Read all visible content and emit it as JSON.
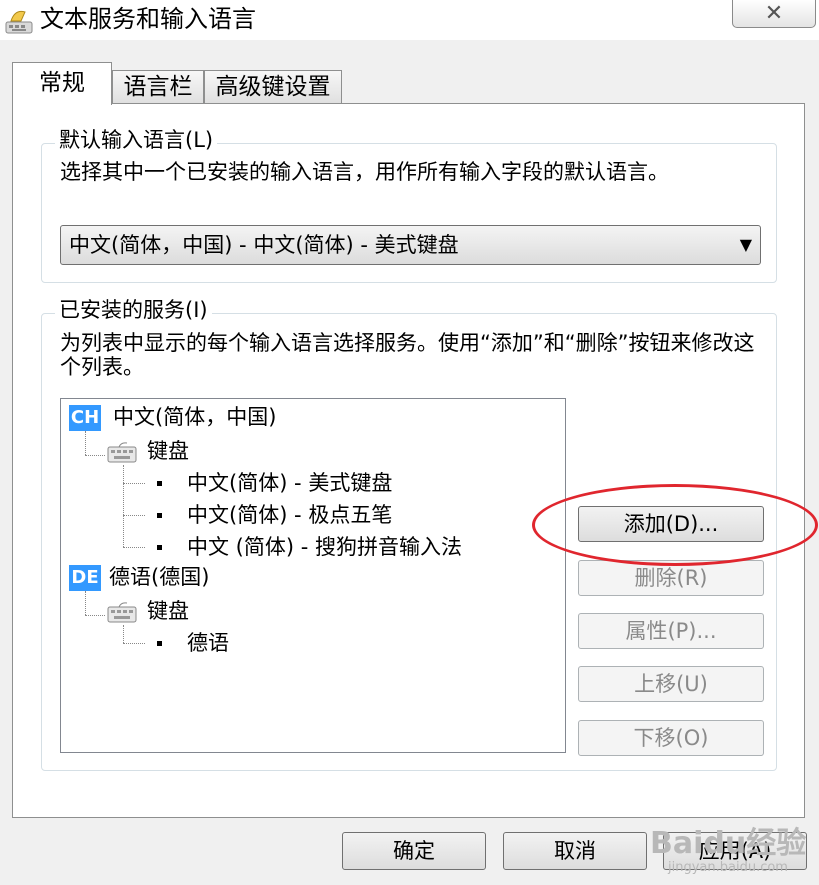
{
  "window": {
    "title": "文本服务和输入语言",
    "close_label": "✕"
  },
  "tabs": [
    {
      "label": "常规",
      "selected": true
    },
    {
      "label": "语言栏",
      "selected": false
    },
    {
      "label": "高级键设置",
      "selected": false
    }
  ],
  "default_language": {
    "group_title": "默认输入语言(L)",
    "description": "选择其中一个已安装的输入语言，用作所有输入字段的默认语言。",
    "selected_value": "中文(简体，中国) - 中文(简体) - 美式键盘"
  },
  "installed_services": {
    "group_title": "已安装的服务(I)",
    "description": "为列表中显示的每个输入语言选择服务。使用“添加”和“删除”按钮来修改这个列表。",
    "tree": [
      {
        "badge": "CH",
        "label": "中文(简体，中国)",
        "category": "键盘",
        "items": [
          "中文(简体) - 美式键盘",
          "中文(简体) - 极点五笔",
          "中文 (简体) - 搜狗拼音输入法"
        ]
      },
      {
        "badge": "DE",
        "label": "德语(德国)",
        "category": "键盘",
        "items": [
          "德语"
        ]
      }
    ],
    "buttons": {
      "add": "添加(D)...",
      "delete": "删除(R)",
      "properties": "属性(P)...",
      "move_up": "上移(U)",
      "move_down": "下移(O)"
    }
  },
  "footer": {
    "ok": "确定",
    "cancel": "取消",
    "apply": "应用(A)"
  },
  "watermark": {
    "text": "Baidu经验",
    "sub": "jingyan.baidu.com"
  },
  "colors": {
    "badge_blue": "#3399ff",
    "highlight_red": "#e0262e",
    "dialog_bg": "#f0f0f0"
  }
}
